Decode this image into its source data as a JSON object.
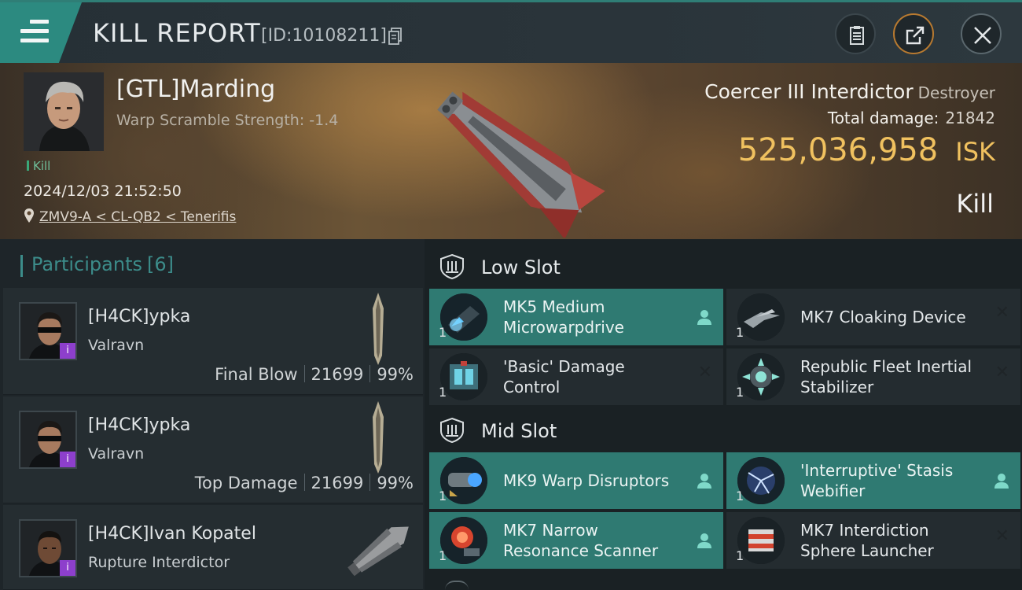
{
  "header": {
    "title": "KILL REPORT",
    "report_id": "[ID:10108211]"
  },
  "victim": {
    "name": "[GTL]Marding",
    "warp_strength": "Warp Scramble Strength: -1.4",
    "kill_tag": "Kill",
    "date": "2024/12/03 21:52:50",
    "location": "ZMV9-A < CL-QB2 < Tenerifis",
    "ship_name": "Coercer III Interdictor",
    "ship_class": "Destroyer",
    "total_damage_label": "Total damage:",
    "total_damage": "21842",
    "isk_value": "525,036,958",
    "isk_unit": "ISK",
    "result": "Kill"
  },
  "participants": {
    "title": "Participants",
    "count": "[6]",
    "rows": [
      {
        "name": "[H4CK]ypka",
        "ship": "Valravn",
        "stat_label": "Final Blow",
        "damage": "21699",
        "percent": "99%"
      },
      {
        "name": "[H4CK]ypka",
        "ship": "Valravn",
        "stat_label": "Top Damage",
        "damage": "21699",
        "percent": "99%"
      },
      {
        "name": "[H4CK]Ivan Kopatel",
        "ship": "Rupture Interdictor"
      }
    ],
    "badge": "i"
  },
  "slots": {
    "low_title": "Low Slot",
    "mid_title": "Mid Slot",
    "low": [
      {
        "name": "MK5 Medium Microwarpdrive",
        "qty": "1",
        "active": true
      },
      {
        "name": "MK7 Cloaking Device",
        "qty": "1",
        "active": false
      },
      {
        "name": "'Basic' Damage Control",
        "qty": "1",
        "active": false
      },
      {
        "name": "Republic Fleet Inertial Stabilizer",
        "qty": "1",
        "active": false
      }
    ],
    "mid": [
      {
        "name": "MK9 Warp Disruptors",
        "qty": "1",
        "active": true
      },
      {
        "name": "'Interruptive' Stasis Webifier",
        "qty": "1",
        "active": true
      },
      {
        "name": "MK7 Narrow Resonance Scanner",
        "qty": "1",
        "active": true
      },
      {
        "name": "MK7 Interdiction Sphere Launcher",
        "qty": "1",
        "active": false
      }
    ]
  },
  "colors": {
    "accent_teal": "#2c8a80",
    "isk_gold": "#f0c15f",
    "badge_purple": "#8d3fcc"
  },
  "icons": [
    "menu-icon",
    "copy-icon",
    "clipboard-icon",
    "share-icon",
    "close-icon",
    "location-pin-icon",
    "shield-slot-icon",
    "person-icon",
    "x-mark-icon"
  ]
}
